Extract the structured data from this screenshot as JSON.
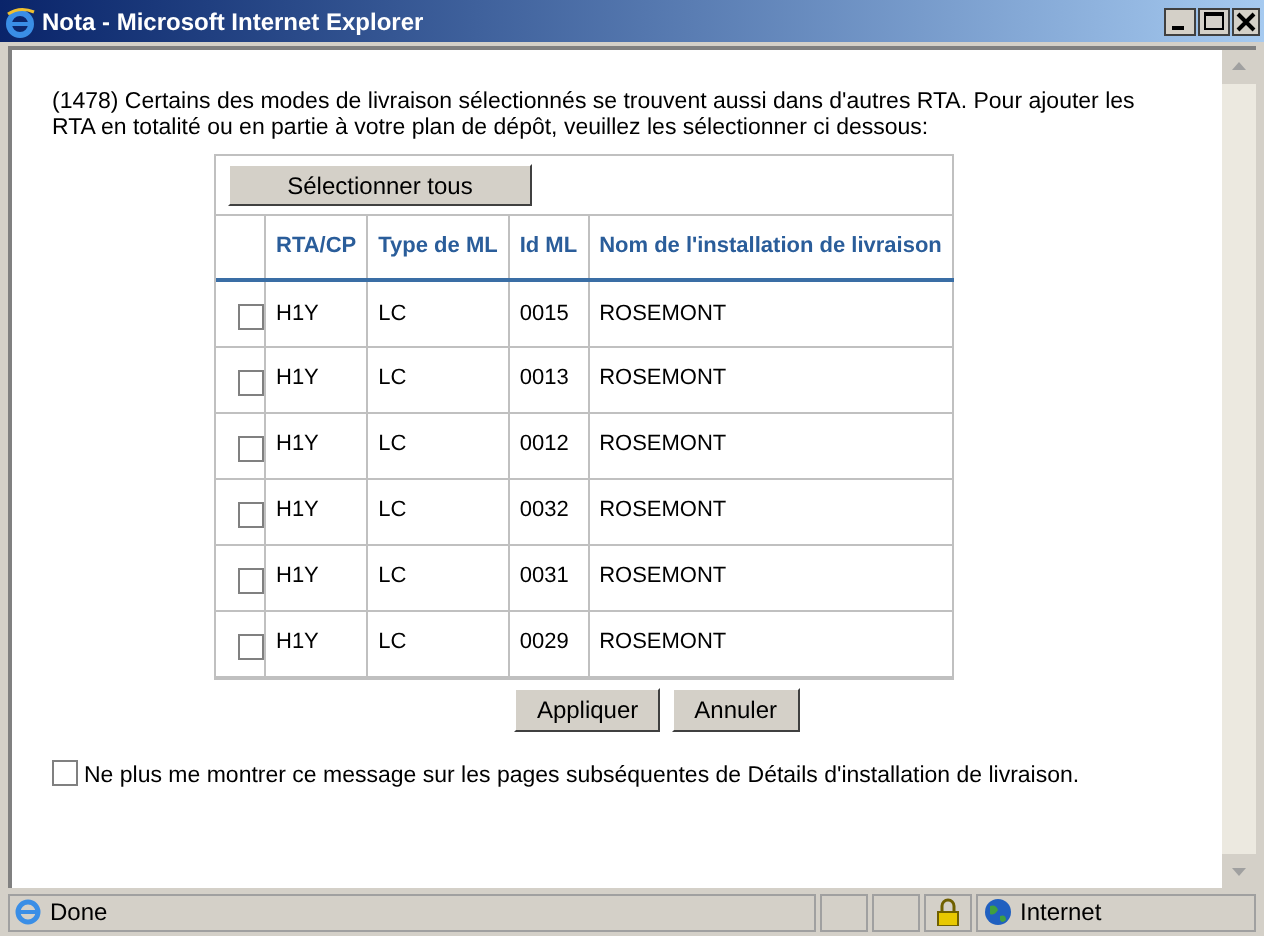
{
  "window": {
    "title": "Nota - Microsoft Internet Explorer"
  },
  "message": "(1478) Certains des modes de livraison sélectionnés se trouvent aussi dans d'autres RTA. Pour ajouter les RTA en totalité ou en partie à votre plan de dépôt, veuillez les sélectionner ci dessous:",
  "select_all_button": "Sélectionner tous",
  "table": {
    "columns": [
      "RTA/CP",
      "Type de ML",
      "Id ML",
      "Nom de l'installation de livraison"
    ],
    "rows": [
      {
        "checked": false,
        "cells": [
          "H1Y",
          "LC",
          "0015",
          "ROSEMONT"
        ]
      },
      {
        "checked": false,
        "cells": [
          "H1Y",
          "LC",
          "0013",
          "ROSEMONT"
        ]
      },
      {
        "checked": false,
        "cells": [
          "H1Y",
          "LC",
          "0012",
          "ROSEMONT"
        ]
      },
      {
        "checked": false,
        "cells": [
          "H1Y",
          "LC",
          "0032",
          "ROSEMONT"
        ]
      },
      {
        "checked": false,
        "cells": [
          "H1Y",
          "LC",
          "0031",
          "ROSEMONT"
        ]
      },
      {
        "checked": false,
        "cells": [
          "H1Y",
          "LC",
          "0029",
          "ROSEMONT"
        ]
      }
    ]
  },
  "buttons": [
    "Appliquer",
    "Annuler"
  ],
  "dont_show": {
    "checked": false,
    "label": "Ne plus me montrer ce message sur les pages subséquentes de Détails d'installation de livraison."
  },
  "status_bar": {
    "text": "Done",
    "zone": "Internet"
  }
}
